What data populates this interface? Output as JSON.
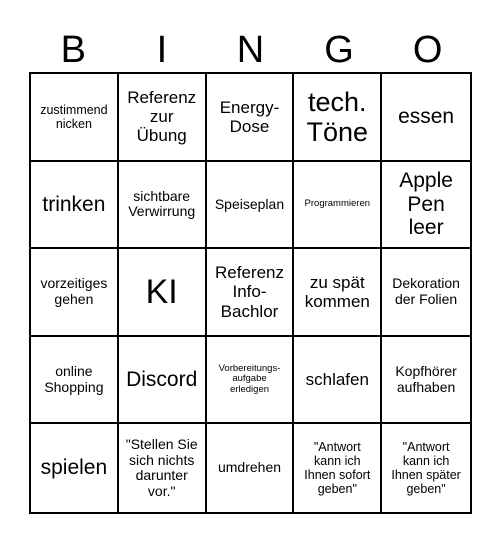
{
  "header": {
    "letters": [
      "B",
      "I",
      "N",
      "G",
      "O"
    ]
  },
  "cells": [
    {
      "text": "zustimmend nicken",
      "size": "s"
    },
    {
      "text": "Referenz zur Übung",
      "size": "l"
    },
    {
      "text": "Energy-Dose",
      "size": "l"
    },
    {
      "text": "tech. Töne",
      "size": "xxl"
    },
    {
      "text": "essen",
      "size": "xl"
    },
    {
      "text": "trinken",
      "size": "xl"
    },
    {
      "text": "sichtbare Verwirrung",
      "size": "m"
    },
    {
      "text": "Speiseplan",
      "size": "m"
    },
    {
      "text": "Programmieren",
      "size": "xs"
    },
    {
      "text": "Apple Pen leer",
      "size": "xl"
    },
    {
      "text": "vorzeitiges gehen",
      "size": "m"
    },
    {
      "text": "KI",
      "size": "huge"
    },
    {
      "text": "Referenz Info-Bachlor",
      "size": "l"
    },
    {
      "text": "zu spät kommen",
      "size": "l"
    },
    {
      "text": "Dekoration der Folien",
      "size": "m"
    },
    {
      "text": "online Shopping",
      "size": "m"
    },
    {
      "text": "Discord",
      "size": "xl"
    },
    {
      "text": "Vorbereitungs-aufgabe erledigen",
      "size": "xs"
    },
    {
      "text": "schlafen",
      "size": "l"
    },
    {
      "text": "Kopfhörer aufhaben",
      "size": "m"
    },
    {
      "text": "spielen",
      "size": "xl"
    },
    {
      "text": "\"Stellen Sie sich nichts darunter vor.\"",
      "size": "m"
    },
    {
      "text": "umdrehen",
      "size": "m"
    },
    {
      "text": "\"Antwort kann ich Ihnen sofort geben\"",
      "size": "s"
    },
    {
      "text": "\"Antwort kann ich Ihnen später geben\"",
      "size": "s"
    }
  ]
}
